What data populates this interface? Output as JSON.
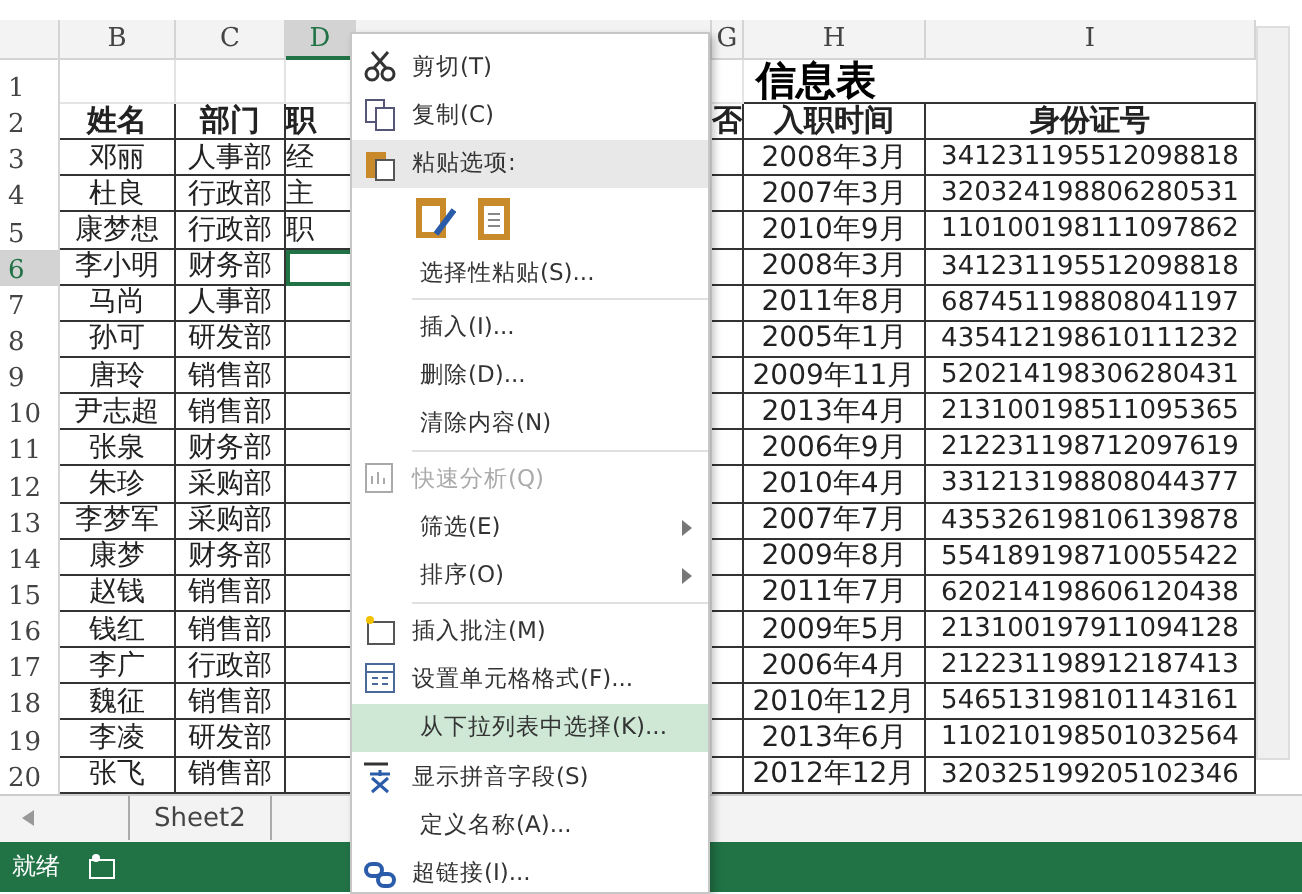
{
  "columns": [
    {
      "label": "B",
      "selected": false
    },
    {
      "label": "C",
      "selected": false
    },
    {
      "label": "D",
      "selected": true
    },
    {
      "label": "G",
      "selected": false
    },
    {
      "label": "H",
      "selected": false
    },
    {
      "label": "I",
      "selected": false
    }
  ],
  "title_row": {
    "row": "1",
    "title": "信息表"
  },
  "header_row": {
    "row": "2",
    "name": "姓名",
    "dept": "部门",
    "col_d": "职",
    "col_g": "否",
    "hire": "入职时间",
    "id": "身份证号"
  },
  "rows": [
    {
      "row": "3",
      "selected": false,
      "name": "邓丽",
      "dept": "人事部",
      "col_d": "经",
      "hire": "2008年3月",
      "id": "341231195512098818"
    },
    {
      "row": "4",
      "selected": false,
      "name": "杜良",
      "dept": "行政部",
      "col_d": "主",
      "hire": "2007年3月",
      "id": "320324198806280531"
    },
    {
      "row": "5",
      "selected": false,
      "name": "康梦想",
      "dept": "行政部",
      "col_d": "职",
      "hire": "2010年9月",
      "id": "110100198111097862"
    },
    {
      "row": "6",
      "selected": true,
      "name": "李小明",
      "dept": "财务部",
      "hire": "2008年3月",
      "id": "341231195512098818"
    },
    {
      "row": "7",
      "selected": false,
      "name": "马尚",
      "dept": "人事部",
      "hire": "2011年8月",
      "id": "687451198808041197"
    },
    {
      "row": "8",
      "selected": false,
      "name": "孙可",
      "dept": "研发部",
      "hire": "2005年1月",
      "id": "435412198610111232"
    },
    {
      "row": "9",
      "selected": false,
      "name": "唐玲",
      "dept": "销售部",
      "hire": "2009年11月",
      "id": "520214198306280431"
    },
    {
      "row": "10",
      "selected": false,
      "name": "尹志超",
      "dept": "销售部",
      "hire": "2013年4月",
      "id": "213100198511095365"
    },
    {
      "row": "11",
      "selected": false,
      "name": "张泉",
      "dept": "财务部",
      "hire": "2006年9月",
      "id": "212231198712097619"
    },
    {
      "row": "12",
      "selected": false,
      "name": "朱珍",
      "dept": "采购部",
      "hire": "2010年4月",
      "id": "331213198808044377"
    },
    {
      "row": "13",
      "selected": false,
      "name": "李梦军",
      "dept": "采购部",
      "hire": "2007年7月",
      "id": "435326198106139878"
    },
    {
      "row": "14",
      "selected": false,
      "name": "康梦",
      "dept": "财务部",
      "hire": "2009年8月",
      "id": "554189198710055422"
    },
    {
      "row": "15",
      "selected": false,
      "name": "赵钱",
      "dept": "销售部",
      "hire": "2011年7月",
      "id": "620214198606120438"
    },
    {
      "row": "16",
      "selected": false,
      "name": "钱红",
      "dept": "销售部",
      "hire": "2009年5月",
      "id": "213100197911094128"
    },
    {
      "row": "17",
      "selected": false,
      "name": "李广",
      "dept": "行政部",
      "hire": "2006年4月",
      "id": "212231198912187413"
    },
    {
      "row": "18",
      "selected": false,
      "name": "魏征",
      "dept": "销售部",
      "hire": "2010年12月",
      "id": "546513198101143161"
    },
    {
      "row": "19",
      "selected": false,
      "name": "李凌",
      "dept": "研发部",
      "hire": "2013年6月",
      "id": "110210198501032564"
    },
    {
      "row": "20",
      "selected": false,
      "name": "张飞",
      "dept": "销售部",
      "hire": "2012年12月",
      "id": "320325199205102346"
    }
  ],
  "sheet_tabs": [
    {
      "label": "Sheet2",
      "selected": false
    }
  ],
  "status_bar": {
    "text": "就绪"
  },
  "context_menu": [
    {
      "kind": "item",
      "label": "剪切(T)",
      "disabled": false,
      "selected": false,
      "submenu": false
    },
    {
      "kind": "item",
      "label": "复制(C)",
      "disabled": false,
      "selected": false,
      "submenu": false
    },
    {
      "kind": "header",
      "label": "粘贴选项:"
    },
    {
      "kind": "paste_icons"
    },
    {
      "kind": "item",
      "label": "选择性粘贴(S)...",
      "disabled": false,
      "selected": false,
      "submenu": false
    },
    {
      "kind": "separator"
    },
    {
      "kind": "item",
      "label": "插入(I)...",
      "disabled": false,
      "selected": false,
      "submenu": false
    },
    {
      "kind": "item",
      "label": "删除(D)...",
      "disabled": false,
      "selected": false,
      "submenu": false
    },
    {
      "kind": "item",
      "label": "清除内容(N)",
      "disabled": false,
      "selected": false,
      "submenu": false
    },
    {
      "kind": "separator"
    },
    {
      "kind": "item",
      "label": "快速分析(Q)",
      "disabled": true,
      "selected": false,
      "submenu": false
    },
    {
      "kind": "item",
      "label": "筛选(E)",
      "disabled": false,
      "selected": false,
      "submenu": true
    },
    {
      "kind": "item",
      "label": "排序(O)",
      "disabled": false,
      "selected": false,
      "submenu": true
    },
    {
      "kind": "separator"
    },
    {
      "kind": "item",
      "label": "插入批注(M)",
      "disabled": false,
      "selected": false,
      "submenu": false
    },
    {
      "kind": "item",
      "label": "设置单元格格式(F)...",
      "disabled": false,
      "selected": false,
      "submenu": false
    },
    {
      "kind": "item",
      "label": "从下拉列表中选择(K)...",
      "disabled": false,
      "selected": true,
      "submenu": false
    },
    {
      "kind": "item",
      "label": "显示拼音字段(S)",
      "disabled": false,
      "selected": false,
      "submenu": false
    },
    {
      "kind": "item",
      "label": "定义名称(A)...",
      "disabled": false,
      "selected": false,
      "submenu": false
    },
    {
      "kind": "item",
      "label": "超链接(I)...",
      "disabled": false,
      "selected": false,
      "submenu": false
    }
  ]
}
